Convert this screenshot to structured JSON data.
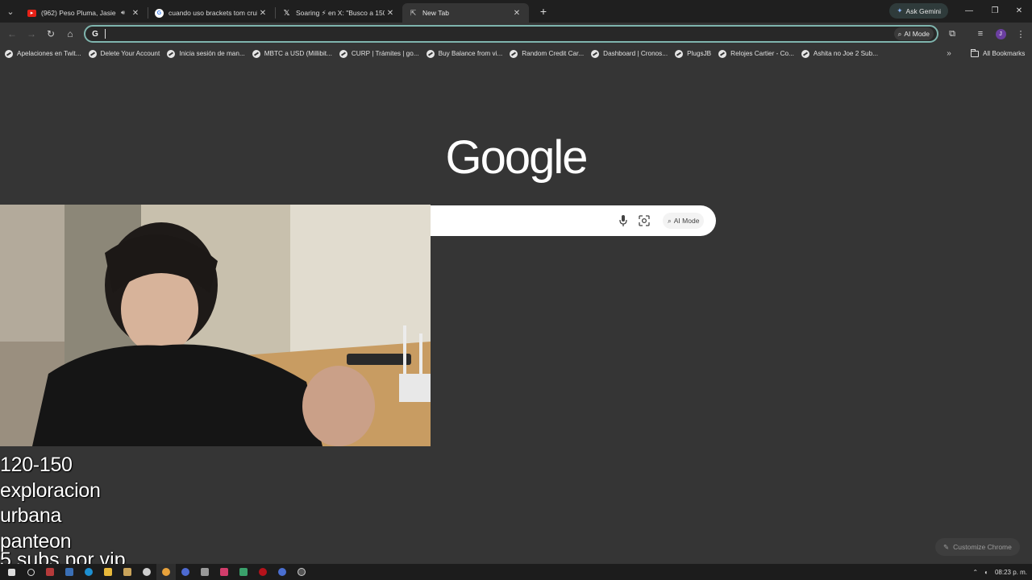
{
  "browser": {
    "tabs": [
      {
        "title": "(962) Peso Pluma, Jasiel Nu",
        "favicon_color": "#e62117",
        "audio": true,
        "active": false
      },
      {
        "title": "cuando uso brackets tom cruise",
        "favicon_color": "#ffffff",
        "audio": false,
        "active": false
      },
      {
        "title": "Soaring ⚡ en X: \"Busco a 150",
        "favicon_color": "#000000",
        "audio": false,
        "active": false
      },
      {
        "title": "New Tab",
        "favicon_color": "",
        "audio": false,
        "active": true
      }
    ],
    "ask_gemini": "Ask Gemini",
    "omnibox": {
      "value": "",
      "ai_mode": "AI Mode"
    },
    "profile_initial": "J",
    "bookmarks": [
      "Apelaciones en Twit...",
      "Delete Your Account",
      "Inicia sesión de man...",
      "MBTC a USD (Millibit...",
      "CURP | Trámites | go...",
      "Buy Balance from vi...",
      "Random Credit Car...",
      "Dashboard | Cronos...",
      "PlugsJB",
      "Relojes Cartier - Co...",
      "Ashita no Joe 2 Sub..."
    ],
    "all_bookmarks": "All Bookmarks"
  },
  "ntp": {
    "logo": "Google",
    "ai_mode": "AI Mode",
    "customize": "Customize Chrome"
  },
  "overlay": {
    "lines": [
      "120-150",
      "exploracion",
      "urbana",
      "panteon"
    ],
    "line5": "5 subs por vip"
  },
  "taskbar": {
    "time": "08:23 p. m."
  }
}
